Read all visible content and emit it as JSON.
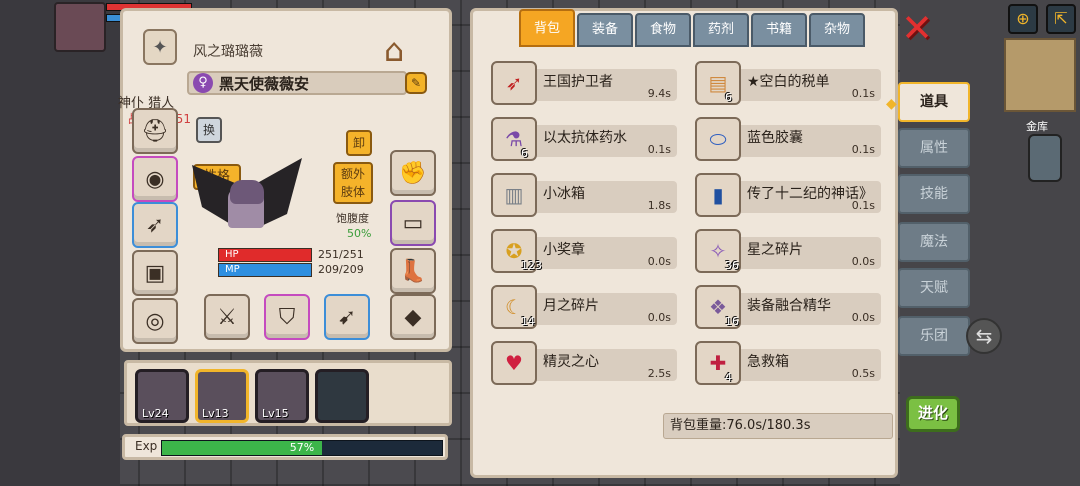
{
  "character": {
    "title": "风之璐璐薇",
    "name": "黑天使薇薇安",
    "class_line": "神仆 猎人",
    "power_label": "战斗力:251",
    "swap_label": "换",
    "unequip_label": "卸",
    "personality_label": "性格",
    "extra_limb_label": "额外\n肢体",
    "satiety_label": "饱腹度",
    "satiety_value": "50%",
    "hp_label": "HP",
    "hp_value": "251/251",
    "mp_label": "MP",
    "mp_value": "209/209"
  },
  "party": {
    "members": [
      {
        "level": "Lv24"
      },
      {
        "level": "Lv13"
      },
      {
        "level": "Lv15"
      }
    ]
  },
  "exp": {
    "label": "Exp",
    "percent": "57%",
    "fraction": 0.57
  },
  "inventory": {
    "tabs": [
      "背包",
      "装备",
      "食物",
      "药剂",
      "书籍",
      "杂物"
    ],
    "active_tab": "背包",
    "items": [
      {
        "name": "王国护卫者",
        "weight": "9.4s",
        "qty": "",
        "icon": "crossbow-icon"
      },
      {
        "name": "★空白的税单",
        "weight": "0.1s",
        "qty": "6",
        "icon": "tax-form-icon"
      },
      {
        "name": "以太抗体药水",
        "weight": "0.1s",
        "qty": "6",
        "icon": "potion-icon"
      },
      {
        "name": "蓝色胶囊",
        "weight": "0.1s",
        "qty": "",
        "icon": "capsule-icon"
      },
      {
        "name": "小冰箱",
        "weight": "1.8s",
        "qty": "",
        "icon": "fridge-icon"
      },
      {
        "name": "传了十二纪的神话》",
        "weight": "0.1s",
        "qty": "",
        "icon": "book-icon"
      },
      {
        "name": "小奖章",
        "weight": "0.0s",
        "qty": "123",
        "icon": "medal-icon"
      },
      {
        "name": "星之碎片",
        "weight": "0.0s",
        "qty": "36",
        "icon": "star-shard-icon"
      },
      {
        "name": "月之碎片",
        "weight": "0.0s",
        "qty": "14",
        "icon": "moon-shard-icon"
      },
      {
        "name": "装备融合精华",
        "weight": "0.0s",
        "qty": "16",
        "icon": "essence-icon"
      },
      {
        "name": "精灵之心",
        "weight": "2.5s",
        "qty": "",
        "icon": "heart-icon"
      },
      {
        "name": "急救箱",
        "weight": "0.5s",
        "qty": "4",
        "icon": "first-aid-icon"
      }
    ],
    "weight_summary": "背包重量:76.0s/180.3s"
  },
  "side_menu": {
    "items": [
      "道具",
      "属性",
      "技能",
      "魔法",
      "天赋",
      "乐团"
    ],
    "active": "道具"
  },
  "vault_label": "金库",
  "evolve_label": "进化",
  "colors": {
    "accent": "#f5a623",
    "panel_bg": "#efe6da",
    "hp": "#e02b2b",
    "mp": "#2e8fe0",
    "exp": "#3cb54a",
    "close": "#e23030"
  }
}
